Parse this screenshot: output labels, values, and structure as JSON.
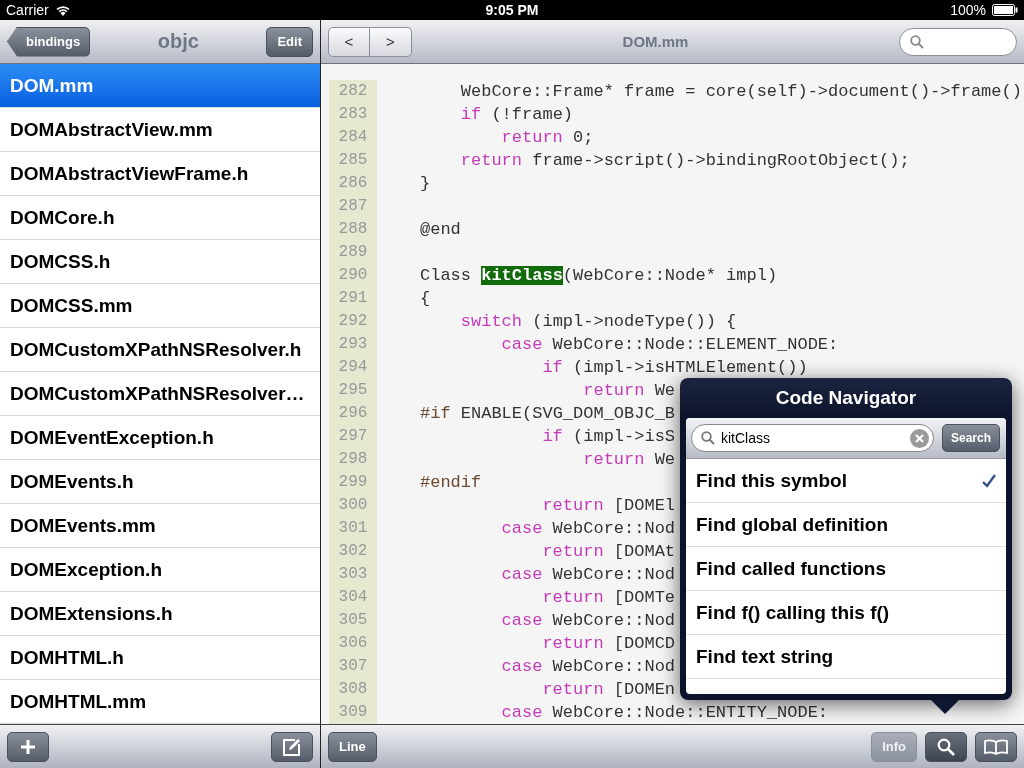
{
  "status_bar": {
    "carrier": "Carrier",
    "time": "9:05 PM",
    "battery": "100%"
  },
  "sidebar": {
    "back_button": "bindings",
    "title": "objc",
    "edit_button": "Edit",
    "files": [
      {
        "name": "DOM.mm",
        "selected": true
      },
      {
        "name": "DOMAbstractView.mm",
        "selected": false
      },
      {
        "name": "DOMAbstractViewFrame.h",
        "selected": false
      },
      {
        "name": "DOMCore.h",
        "selected": false
      },
      {
        "name": "DOMCSS.h",
        "selected": false
      },
      {
        "name": "DOMCSS.mm",
        "selected": false
      },
      {
        "name": "DOMCustomXPathNSResolver.h",
        "selected": false
      },
      {
        "name": "DOMCustomXPathNSResolver…",
        "selected": false
      },
      {
        "name": "DOMEventException.h",
        "selected": false
      },
      {
        "name": "DOMEvents.h",
        "selected": false
      },
      {
        "name": "DOMEvents.mm",
        "selected": false
      },
      {
        "name": "DOMException.h",
        "selected": false
      },
      {
        "name": "DOMExtensions.h",
        "selected": false
      },
      {
        "name": "DOMHTML.h",
        "selected": false
      },
      {
        "name": "DOMHTML.mm",
        "selected": false
      }
    ]
  },
  "editor": {
    "back_button": "<",
    "forward_button": ">",
    "title": "DOM.mm",
    "lines": [
      {
        "num": "282",
        "tokens": [
          {
            "kind": "plain",
            "text": "    WebCore::Frame* frame = core(self)->document()->frame()"
          }
        ]
      },
      {
        "num": "283",
        "tokens": [
          {
            "kind": "keyword",
            "text": "    if"
          },
          {
            "kind": "plain",
            "text": " (!frame)"
          }
        ]
      },
      {
        "num": "284",
        "tokens": [
          {
            "kind": "keyword",
            "text": "        return"
          },
          {
            "kind": "plain",
            "text": " 0;"
          }
        ]
      },
      {
        "num": "285",
        "tokens": [
          {
            "kind": "keyword",
            "text": "    return"
          },
          {
            "kind": "plain",
            "text": " frame->script()->bindingRootObject();"
          }
        ]
      },
      {
        "num": "286",
        "tokens": [
          {
            "kind": "plain",
            "text": "}"
          }
        ]
      },
      {
        "num": "287"
      },
      {
        "num": "288",
        "tokens": [
          {
            "kind": "plain",
            "text": "@end"
          }
        ]
      },
      {
        "num": "289"
      },
      {
        "num": "290",
        "tokens": [
          {
            "kind": "plain",
            "text": "Class "
          },
          {
            "kind": "match",
            "text": "kitClass"
          },
          {
            "kind": "plain",
            "text": "(WebCore::Node* impl)"
          }
        ]
      },
      {
        "num": "291",
        "tokens": [
          {
            "kind": "plain",
            "text": "{"
          }
        ]
      },
      {
        "num": "292",
        "tokens": [
          {
            "kind": "keyword",
            "text": "    switch"
          },
          {
            "kind": "plain",
            "text": " (impl->nodeType()) {"
          }
        ]
      },
      {
        "num": "293",
        "tokens": [
          {
            "kind": "keyword",
            "text": "        case"
          },
          {
            "kind": "plain",
            "text": " WebCore::Node::ELEMENT_NODE:"
          }
        ]
      },
      {
        "num": "294",
        "tokens": [
          {
            "kind": "keyword",
            "text": "            if"
          },
          {
            "kind": "plain",
            "text": " (impl->isHTMLElement())"
          }
        ]
      },
      {
        "num": "295",
        "tokens": [
          {
            "kind": "keyword",
            "text": "                return"
          },
          {
            "kind": "plain",
            "text": " We"
          }
        ]
      },
      {
        "num": "296",
        "tokens": [
          {
            "kind": "directive",
            "text": "#if"
          },
          {
            "kind": "plain",
            "text": " ENABLE(SVG_DOM_OBJC_B"
          }
        ]
      },
      {
        "num": "297",
        "tokens": [
          {
            "kind": "keyword",
            "text": "            if"
          },
          {
            "kind": "plain",
            "text": " (impl->isS"
          }
        ]
      },
      {
        "num": "298",
        "tokens": [
          {
            "kind": "keyword",
            "text": "                return"
          },
          {
            "kind": "plain",
            "text": " We"
          }
        ]
      },
      {
        "num": "299",
        "tokens": [
          {
            "kind": "directive",
            "text": "#endif"
          }
        ]
      },
      {
        "num": "300",
        "tokens": [
          {
            "kind": "keyword",
            "text": "            return"
          },
          {
            "kind": "plain",
            "text": " [DOMEl"
          }
        ]
      },
      {
        "num": "301",
        "tokens": [
          {
            "kind": "keyword",
            "text": "        case"
          },
          {
            "kind": "plain",
            "text": " WebCore::Nod"
          }
        ]
      },
      {
        "num": "302",
        "tokens": [
          {
            "kind": "keyword",
            "text": "            return"
          },
          {
            "kind": "plain",
            "text": " [DOMAt"
          }
        ]
      },
      {
        "num": "303",
        "tokens": [
          {
            "kind": "keyword",
            "text": "        case"
          },
          {
            "kind": "plain",
            "text": " WebCore::Nod"
          }
        ]
      },
      {
        "num": "304",
        "tokens": [
          {
            "kind": "keyword",
            "text": "            return"
          },
          {
            "kind": "plain",
            "text": " [DOMTe"
          }
        ]
      },
      {
        "num": "305",
        "tokens": [
          {
            "kind": "keyword",
            "text": "        case"
          },
          {
            "kind": "plain",
            "text": " WebCore::Nod"
          }
        ]
      },
      {
        "num": "306",
        "tokens": [
          {
            "kind": "keyword",
            "text": "            return"
          },
          {
            "kind": "plain",
            "text": " [DOMCD"
          }
        ]
      },
      {
        "num": "307",
        "tokens": [
          {
            "kind": "keyword",
            "text": "        case"
          },
          {
            "kind": "plain",
            "text": " WebCore::Nod"
          }
        ]
      },
      {
        "num": "308",
        "tokens": [
          {
            "kind": "keyword",
            "text": "            return"
          },
          {
            "kind": "plain",
            "text": " [DOMEn"
          }
        ]
      },
      {
        "num": "309",
        "tokens": [
          {
            "kind": "keyword",
            "text": "        case"
          },
          {
            "kind": "plain",
            "text": " WebCore::Node::ENTITY_NODE:"
          }
        ]
      }
    ],
    "line_button": "Line",
    "info_button": {
      "label": "Info",
      "disabled": true
    }
  },
  "popover": {
    "title": "Code Navigator",
    "search_value": "kitClass",
    "search_button": "Search",
    "options": [
      {
        "label": "Find this symbol",
        "selected": true
      },
      {
        "label": "Find global definition",
        "selected": false
      },
      {
        "label": "Find called functions",
        "selected": false
      },
      {
        "label": "Find f() calling this f()",
        "selected": false
      },
      {
        "label": "Find text string",
        "selected": false
      }
    ]
  }
}
